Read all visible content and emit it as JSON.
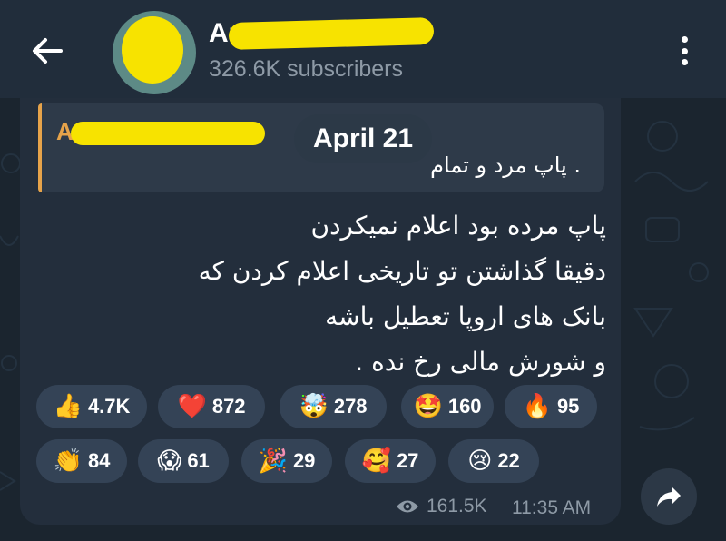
{
  "colors": {
    "background": "#1b252f",
    "header": "#212d3b",
    "bubble": "#232e3c",
    "reply_accent": "#e6a34a",
    "redaction": "#f7e300",
    "reaction_chip": "#344356",
    "muted_text": "#8e9aa6"
  },
  "header": {
    "back_icon": "arrow-left-icon",
    "channel_name": "Ar",
    "subscribers": "326.6K subscribers",
    "menu_icon": "kebab-menu-icon"
  },
  "message": {
    "date_label": "April 21",
    "reply": {
      "author": "A",
      "text": "پاپ مرد و تمام ."
    },
    "lines": [
      "پاپ مرده بود اعلام نمیکردن",
      "دقیقا گذاشتن تو تاریخی اعلام کردن که",
      "بانک های اروپا تعطیل باشه",
      "و شورش مالی رخ نده ."
    ],
    "reactions": [
      {
        "emoji": "👍",
        "count": "4.7K"
      },
      {
        "emoji": "❤️",
        "count": "872"
      },
      {
        "emoji": "🤯",
        "count": "278"
      },
      {
        "emoji": "🤩",
        "count": "160"
      },
      {
        "emoji": "🔥",
        "count": "95"
      },
      {
        "emoji": "👏",
        "count": "84"
      },
      {
        "emoji": "😱",
        "count": "61"
      },
      {
        "emoji": "🎉",
        "count": "29"
      },
      {
        "emoji": "🥰",
        "count": "27"
      },
      {
        "emoji": "😢",
        "count": "22"
      }
    ],
    "views_icon": "eye-icon",
    "views": "161.5K",
    "time": "11:35 AM",
    "share_icon": "share-arrow-icon"
  }
}
